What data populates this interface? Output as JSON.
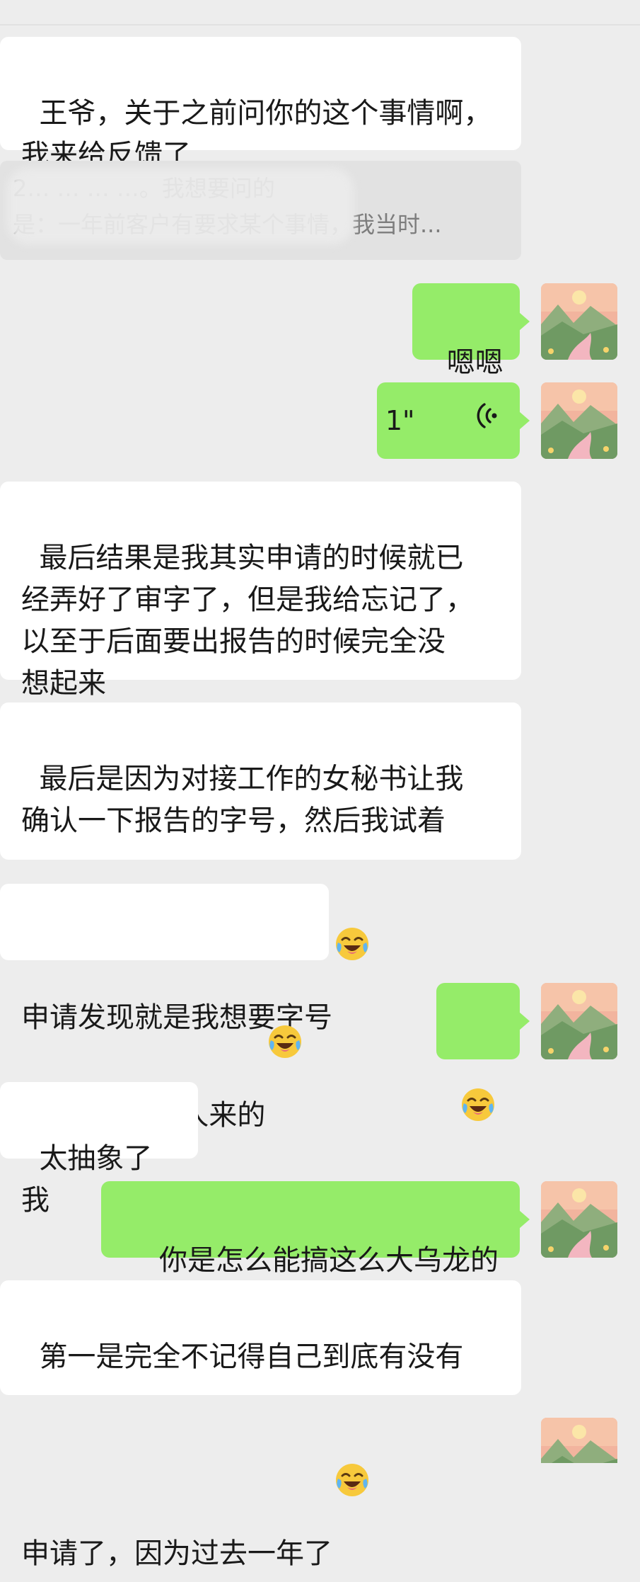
{
  "chat": {
    "messages": [
      {
        "side": "left",
        "type": "text",
        "text": "王爷，关于之前问你的这个事情啊，\n我来给反馈了"
      },
      {
        "side": "left",
        "type": "quote",
        "line1": "2…  …  …  …。我想要问的",
        "line2": "是：一年前客户有要求某个事情，我当时..."
      },
      {
        "side": "right",
        "type": "text",
        "text": "嗯嗯"
      },
      {
        "side": "right",
        "type": "voice",
        "duration": "1\""
      },
      {
        "side": "left",
        "type": "text",
        "text": "最后结果是我其实申请的时候就已\n经弄好了审字了，但是我给忘记了，\n以至于后面要出报告的时候完全没\n想起来"
      },
      {
        "side": "left",
        "type": "text",
        "text": "最后是因为对接工作的女秘书让我\n确认一下报告的字号，然后我试着\n申请发现就是我想要字号",
        "emoji": "crying-laughing"
      },
      {
        "side": "left",
        "type": "text",
        "text": "我真的是神人来的",
        "emoji": "crying-laughing"
      },
      {
        "side": "right",
        "type": "emoji",
        "emoji": "crying-laughing"
      },
      {
        "side": "left",
        "type": "text",
        "text": "太抽象了我"
      },
      {
        "side": "right",
        "type": "text",
        "text": "你是怎么能搞这么大乌龙的"
      },
      {
        "side": "left",
        "type": "text",
        "text": "第一是完全不记得自己到底有没有\n申请了，因为过去一年了",
        "emoji": "crying-laughing"
      }
    ]
  },
  "colors": {
    "background": "#ededed",
    "bubble_left": "#ffffff",
    "bubble_right": "#95ec69",
    "text": "#191919",
    "quote_text": "#7d7d7d"
  },
  "icons": {
    "avatar": "landscape-sunset-avatar",
    "voice": "voice-wave-icon",
    "emoji": "face-with-tears-of-joy"
  }
}
